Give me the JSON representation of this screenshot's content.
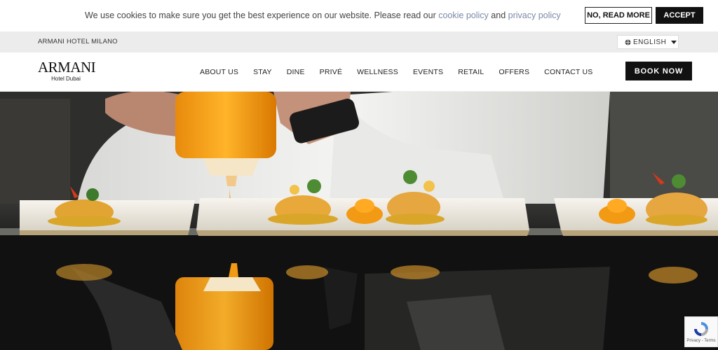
{
  "cookie": {
    "text_before": "We use cookies to make sure you get the best experience on our website. Please read our ",
    "cookie_link": "cookie policy",
    "text_and": " and ",
    "privacy_link": "privacy policy",
    "read_more_label": "NO, READ MORE",
    "accept_label": "ACCEPT"
  },
  "top_strip": {
    "hotel_name": "ARMANI HOTEL MILANO",
    "language": "ENGLISH",
    "language_icon": "globe-icon"
  },
  "header": {
    "logo_main": "ARMANI",
    "logo_sub": "Hotel Dubai",
    "nav": [
      {
        "label": "ABOUT US"
      },
      {
        "label": "STAY"
      },
      {
        "label": "DINE"
      },
      {
        "label": "PRIVÉ"
      },
      {
        "label": "WELLNESS"
      },
      {
        "label": "EVENTS"
      },
      {
        "label": "RETAIL"
      },
      {
        "label": "OFFERS"
      },
      {
        "label": "CONTACT US"
      }
    ],
    "book_label": "BOOK NOW"
  },
  "recaptcha": {
    "label": "Privacy - Terms"
  },
  "colors": {
    "accent": "#111111",
    "link": "#7a8aa8",
    "strip_bg": "#ececec",
    "sauce": "#f29a14"
  }
}
